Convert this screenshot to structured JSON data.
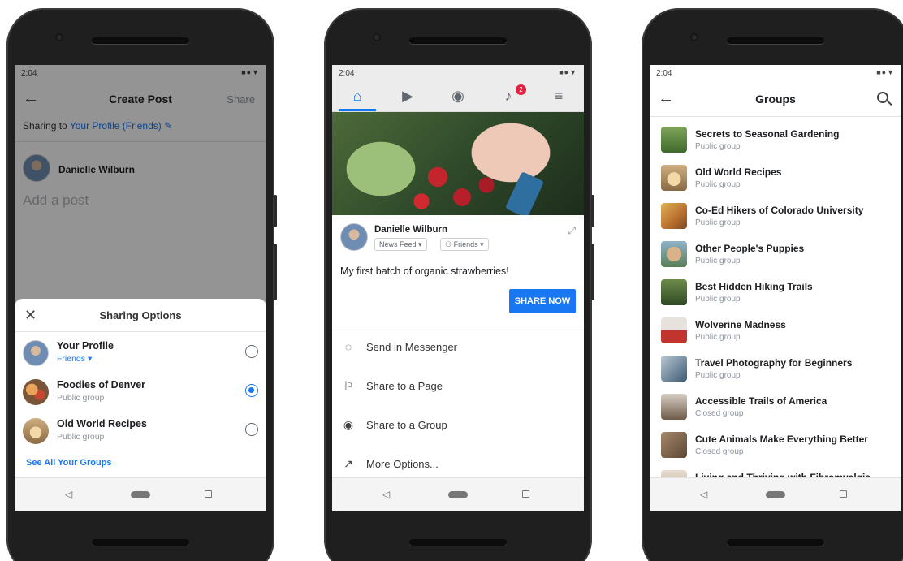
{
  "phone1": {
    "status_time": "2:04",
    "header": {
      "title": "Create Post",
      "share_label": "Share"
    },
    "sharing_prefix": "Sharing to",
    "sharing_target": "Your Profile (Friends)",
    "author": "Danielle Wilburn",
    "add_post_placeholder": "Add a post",
    "sheet": {
      "title": "Sharing Options",
      "options": [
        {
          "name": "Your Profile",
          "sub": "Friends",
          "selected": false
        },
        {
          "name": "Foodies of Denver",
          "sub": "Public group",
          "selected": true
        },
        {
          "name": "Old World Recipes",
          "sub": "Public group",
          "selected": false
        }
      ],
      "see_all": "See All Your Groups"
    }
  },
  "phone2": {
    "status_time": "2:04",
    "notification_count": "2",
    "post": {
      "author": "Danielle Wilburn",
      "audience_feed": "News Feed",
      "audience_friends": "Friends",
      "text": "My first batch of organic strawberries!",
      "share_now": "SHARE NOW"
    },
    "share_options": [
      {
        "label": "Send in Messenger",
        "icon": "messenger-icon"
      },
      {
        "label": "Share to a Page",
        "icon": "flag-icon"
      },
      {
        "label": "Share to a Group",
        "icon": "group-icon"
      },
      {
        "label": "More Options...",
        "icon": "external-icon"
      }
    ]
  },
  "phone3": {
    "status_time": "2:04",
    "title": "Groups",
    "groups": [
      {
        "name": "Secrets to Seasonal Gardening",
        "type": "Public group"
      },
      {
        "name": "Old World Recipes",
        "type": "Public group"
      },
      {
        "name": "Co-Ed Hikers of Colorado University",
        "type": "Public group"
      },
      {
        "name": "Other People's Puppies",
        "type": "Public group"
      },
      {
        "name": "Best Hidden Hiking Trails",
        "type": "Public group"
      },
      {
        "name": "Wolverine Madness",
        "type": "Public group"
      },
      {
        "name": "Travel Photography for Beginners",
        "type": "Public group"
      },
      {
        "name": "Accessible Trails of America",
        "type": "Closed group"
      },
      {
        "name": "Cute Animals Make Everything Better",
        "type": "Closed group"
      },
      {
        "name": "Living and Thriving with Fibromyalgia",
        "type": ""
      }
    ]
  },
  "colors": {
    "accent": "#1877f2",
    "badge": "#e41e3f"
  }
}
